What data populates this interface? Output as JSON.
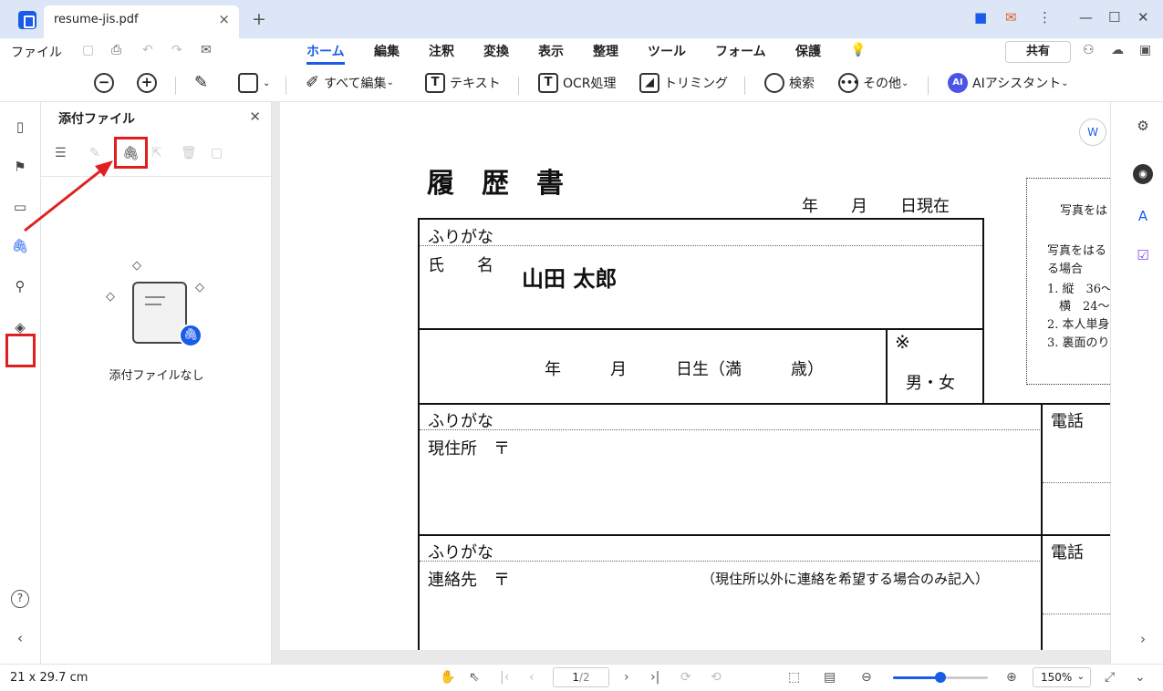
{
  "titlebar": {
    "tab_name": "resume-jis.pdf",
    "close": "×",
    "new_tab": "+"
  },
  "menubar": {
    "file": "ファイル",
    "tabs": [
      "ホーム",
      "編集",
      "注釈",
      "変換",
      "表示",
      "整理",
      "ツール",
      "フォーム",
      "保護"
    ],
    "active_tab": "ホーム",
    "share": "共有"
  },
  "toolbar": {
    "edit_all": "すべて編集",
    "text": "テキスト",
    "ocr": "OCR処理",
    "trim": "トリミング",
    "search": "検索",
    "more": "その他",
    "ai_assistant": "AIアシスタント",
    "ai_badge": "AI"
  },
  "panel": {
    "title": "添付ファイル",
    "empty_text": "添付ファイルなし"
  },
  "resume": {
    "title": "履　歴　書",
    "date_line": "年　　月　　日現在",
    "furigana": "ふりがな",
    "name_label": "氏　　名",
    "name_value": "山田 太郎",
    "birth_line": "年　　　月　　　日生（満　　　歳）",
    "kome": "※",
    "gender": "男・女",
    "address_label": "現住所　〒",
    "phone": "電話",
    "contact_label": "連絡先　〒",
    "contact_note": "（現住所以外に連絡を希望する場合のみ記入）",
    "photo_lines": [
      "写真をは",
      "写真をはる",
      "る場合",
      "1. 縦　36〜",
      "　横　24〜",
      "2. 本人単身",
      "3. 裏面のり"
    ]
  },
  "status": {
    "size": "21 x 29.7 cm",
    "page_current": "1",
    "page_total": "/2",
    "zoom": "150%",
    "zoom_fraction": 0.5
  },
  "colors": {
    "accent": "#1a5ce8",
    "highlight": "#e02020"
  }
}
